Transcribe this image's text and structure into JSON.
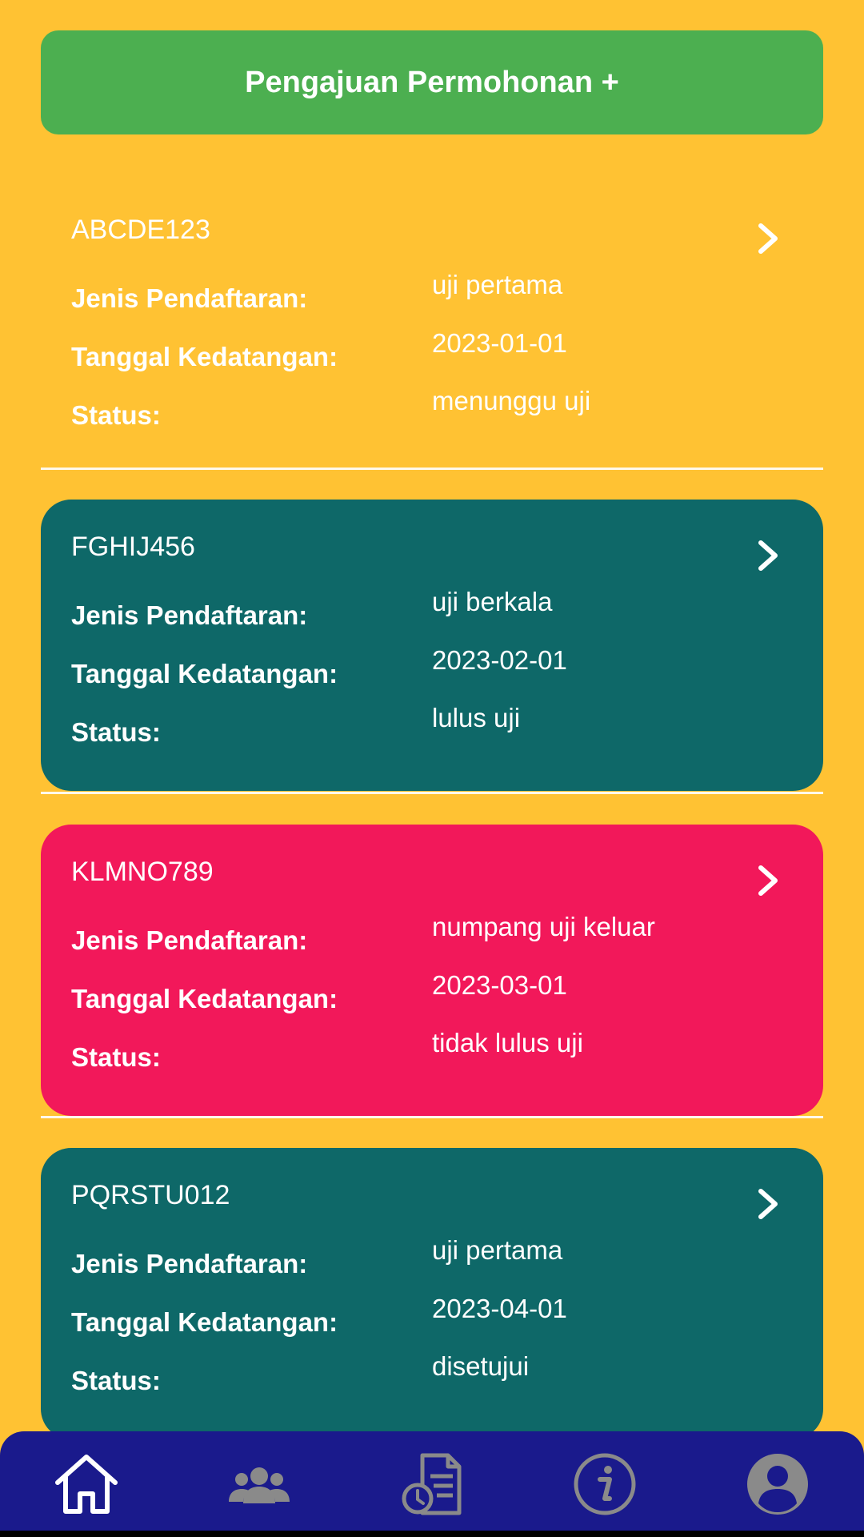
{
  "header": {
    "add_button_label": "Pengajuan Permohonan +"
  },
  "labels": {
    "registration_type": "Jenis Pendaftaran:",
    "arrival_date": "Tanggal Kedatangan:",
    "status": "Status:"
  },
  "cards": [
    {
      "id": "ABCDE123",
      "registration_type": "uji pertama",
      "arrival_date": "2023-01-01",
      "status": "menunggu uji",
      "background": "#FFC233"
    },
    {
      "id": "FGHIJ456",
      "registration_type": "uji berkala",
      "arrival_date": "2023-02-01",
      "status": "lulus uji",
      "background": "#0E6868"
    },
    {
      "id": "KLMNO789",
      "registration_type": "numpang uji keluar",
      "arrival_date": "2023-03-01",
      "status": "tidak lulus uji",
      "background": "#F2185A"
    },
    {
      "id": "PQRSTU012",
      "registration_type": "uji pertama",
      "arrival_date": "2023-04-01",
      "status": "disetujui",
      "background": "#0E6868"
    }
  ],
  "nav": {
    "items": [
      {
        "icon": "home-icon",
        "active": true
      },
      {
        "icon": "people-icon",
        "active": false
      },
      {
        "icon": "document-history-icon",
        "active": false
      },
      {
        "icon": "info-icon",
        "active": false
      },
      {
        "icon": "account-icon",
        "active": false
      }
    ],
    "background": "#1A1A8C"
  },
  "colors": {
    "page_background": "#FFC233",
    "add_button": "#4CAF50",
    "text": "#FFFFFF",
    "nav_inactive_icon": "#8A8A8A",
    "nav_active_icon": "#FFFFFF"
  }
}
